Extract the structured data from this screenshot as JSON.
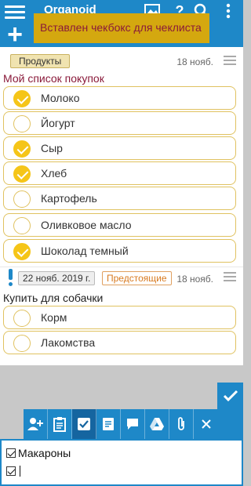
{
  "app": {
    "title": "Organoid"
  },
  "appbar": {
    "icons": [
      "menu-icon",
      "add-icon",
      "image-icon",
      "help-icon",
      "search-icon",
      "more-vert-icon"
    ]
  },
  "toast": {
    "text": "Вставлен чекбокс для чеклиста"
  },
  "note1": {
    "tag": "Продукты",
    "date": "18 нояб.",
    "title": "Мой список покупок",
    "items": [
      {
        "label": "Молоко",
        "checked": true
      },
      {
        "label": "Йогурт",
        "checked": false
      },
      {
        "label": "Сыр",
        "checked": true
      },
      {
        "label": "Хлеб",
        "checked": true
      },
      {
        "label": "Картофель",
        "checked": false
      },
      {
        "label": "Оливковое масло",
        "checked": false
      },
      {
        "label": "Шоколад темный",
        "checked": true
      }
    ]
  },
  "note2": {
    "reminder_date": "22 нояб. 2019 г.",
    "status": "Предстоящие",
    "date": "18 нояб.",
    "title": "Купить для собачки",
    "items": [
      {
        "label": "Корм",
        "checked": false
      },
      {
        "label": "Лакомства",
        "checked": false
      }
    ]
  },
  "toolbar": {
    "buttons": [
      "add-contact-icon",
      "clipboard-icon",
      "checkbox-icon",
      "note-icon",
      "comment-icon",
      "drive-icon",
      "attach-icon",
      "close-icon"
    ],
    "active": "checkbox-icon"
  },
  "editor": {
    "lines": [
      "Макароны",
      ""
    ]
  },
  "colors": {
    "primary": "#1e88c8",
    "accent": "#f5c518",
    "toast": "#d4a80f",
    "title": "#8a1a3a"
  }
}
